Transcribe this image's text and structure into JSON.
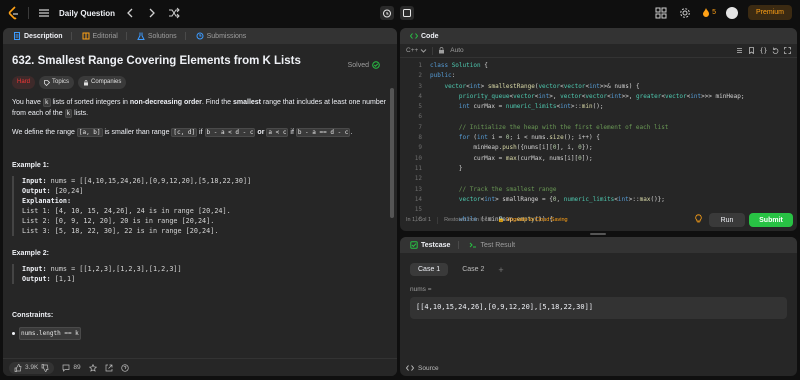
{
  "nav": {
    "title": "Daily Question",
    "streak_count": "5",
    "premium_label": "Premium"
  },
  "left": {
    "tabs": [
      {
        "label": "Description",
        "icon": "document-icon"
      },
      {
        "label": "Editorial",
        "icon": "book-icon"
      },
      {
        "label": "Solutions",
        "icon": "flask-icon"
      },
      {
        "label": "Submissions",
        "icon": "history-icon"
      }
    ],
    "problem_title": "632. Smallest Range Covering Elements from K Lists",
    "solved_label": "Solved",
    "tags": {
      "difficulty": "Hard",
      "topics": "Topics",
      "companies": "Companies"
    },
    "desc": {
      "p1_a": "You have ",
      "p1_k": "k",
      "p1_b": " lists of sorted integers in ",
      "p1_bold1": "non-decreasing order",
      "p1_c": ". Find the ",
      "p1_bold2": "smallest",
      "p1_d": " range that includes at least one number from each of the ",
      "p1_k2": "k",
      "p1_e": " lists.",
      "p2_a": "We define the range ",
      "p2_c1": "[a, b]",
      "p2_b": " is smaller than range ",
      "p2_c2": "[c, d]",
      "p2_c": " if ",
      "p2_c3": "b - a < d - c",
      "p2_or": "or",
      "p2_c4": "a < c",
      "p2_d": " if ",
      "p2_c5": "b - a == d - c",
      "p2_e": "."
    },
    "example1": {
      "title": "Example 1:",
      "input_label": "Input:",
      "input": " nums = [[4,10,15,24,26],[0,9,12,20],[5,18,22,30]]",
      "output_label": "Output:",
      "output": " [20,24]",
      "expl_label": "Explanation:",
      "lines": [
        "List 1: [4, 10, 15, 24,26], 24 is in range [20,24].",
        "List 2: [0, 9, 12, 20], 20 is in range [20,24].",
        "List 3: [5, 18, 22, 30], 22 is in range [20,24]."
      ]
    },
    "example2": {
      "title": "Example 2:",
      "input_label": "Input:",
      "input": " nums = [[1,2,3],[1,2,3],[1,2,3]]",
      "output_label": "Output:",
      "output": " [1,1]"
    },
    "constraints_title": "Constraints:",
    "constraint1": "nums.length == k",
    "status": {
      "likes": "3.9K",
      "comments": "89"
    }
  },
  "code": {
    "title": "Code",
    "language": "C++",
    "mode": "Auto",
    "line_numbers": [
      "1",
      "2",
      "3",
      "4",
      "5",
      "6",
      "7",
      "8",
      "9",
      "10",
      "11",
      "12",
      "13",
      "14",
      "15",
      "16"
    ],
    "cursor": "In 1, Col 1",
    "restored": "Restored from local",
    "upgrade": "Upgrade to Cloud Saving",
    "run_label": "Run",
    "submit_label": "Submit"
  },
  "test": {
    "tabs": [
      "Testcase",
      "Test Result"
    ],
    "cases": [
      "Case 1",
      "Case 2"
    ],
    "var_name": "nums =",
    "var_value": "[[4,10,15,24,26],[0,9,12,20],[5,18,22,30]]",
    "source_label": "Source"
  },
  "colors": {
    "accent": "#ffa116",
    "submit": "#28c244",
    "hard": "#f63737"
  }
}
